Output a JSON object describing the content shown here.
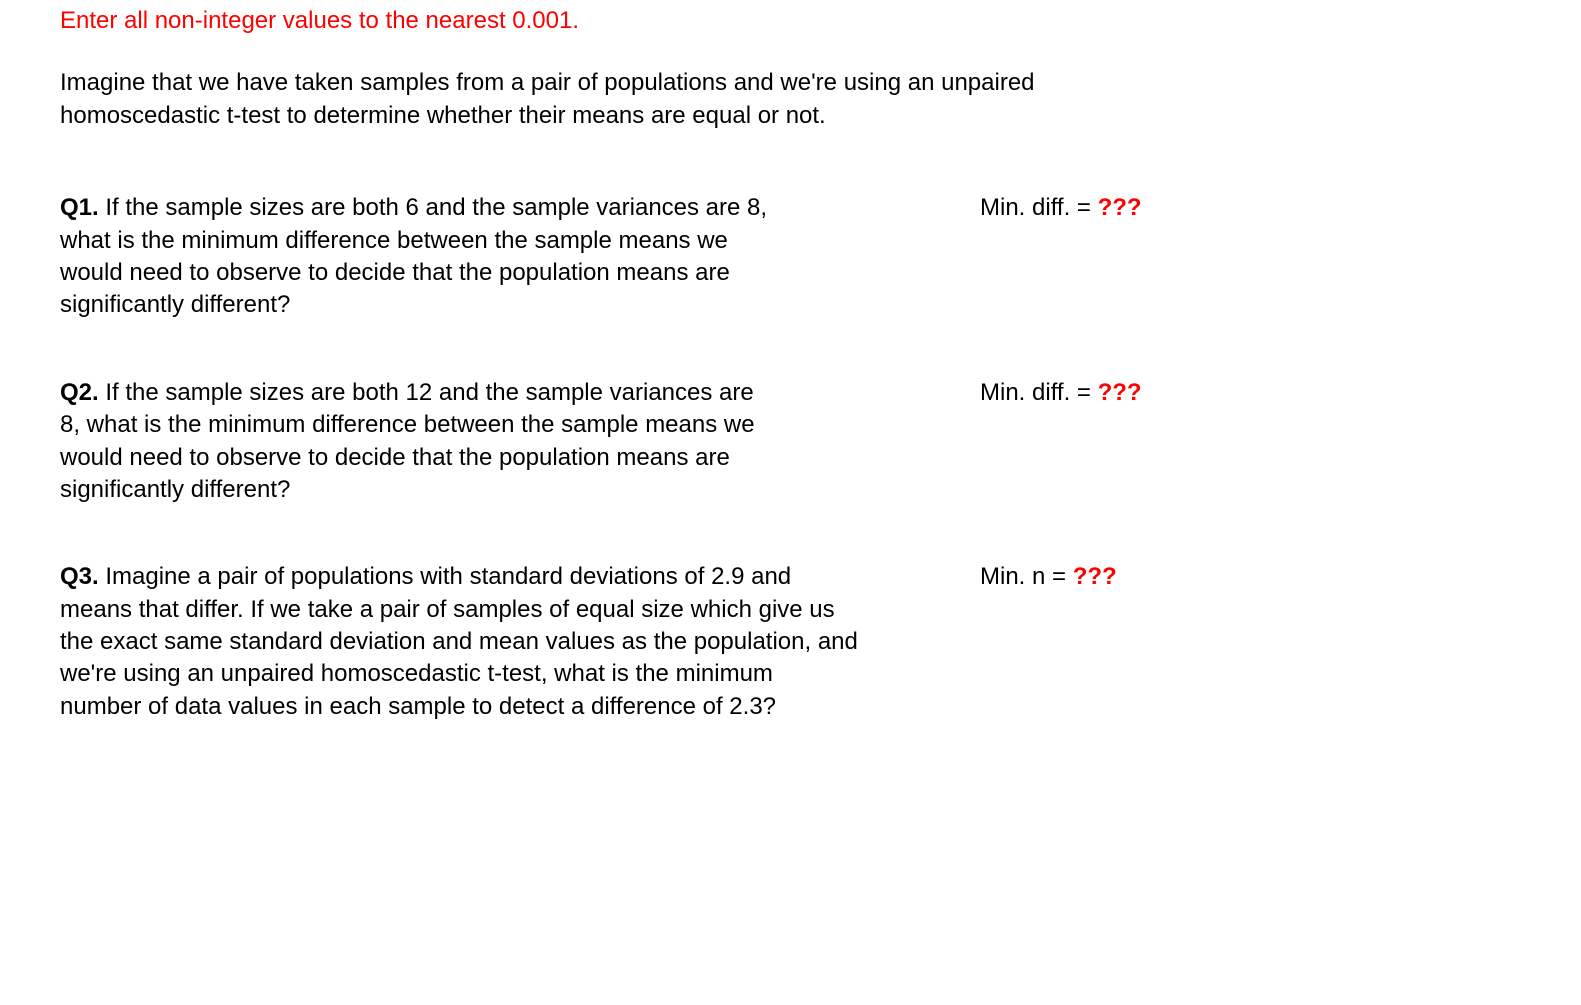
{
  "instruction": "Enter all non-integer values to the nearest 0.001.",
  "intro": "Imagine that we have taken samples from a pair of populations and we're using an unpaired homoscedastic t-test to determine whether their means are equal or not.",
  "questions": {
    "q1": {
      "label": "Q1.",
      "text": " If the sample sizes are both 6 and the sample variances are 8, what is the minimum difference between the sample means we would need to observe to decide that the population means are significantly different?",
      "answer_label": "Min. diff. = ",
      "answer_value": "???"
    },
    "q2": {
      "label": "Q2.",
      "text": " If the sample sizes are both 12 and the sample variances are 8, what is the minimum difference between the sample means we would need to observe to decide that the population means are significantly different?",
      "answer_label": "Min. diff. = ",
      "answer_value": "???"
    },
    "q3": {
      "label": "Q3.",
      "text": " Imagine a pair of populations with standard deviations of 2.9 and means that differ. If we take a pair of samples of equal size which give us the exact same standard deviation and mean values as the population, and we're using an unpaired homoscedastic t-test, what is the minimum number of data values  in each sample to detect a difference of 2.3?",
      "answer_label": "Min. n = ",
      "answer_value": "???"
    }
  }
}
